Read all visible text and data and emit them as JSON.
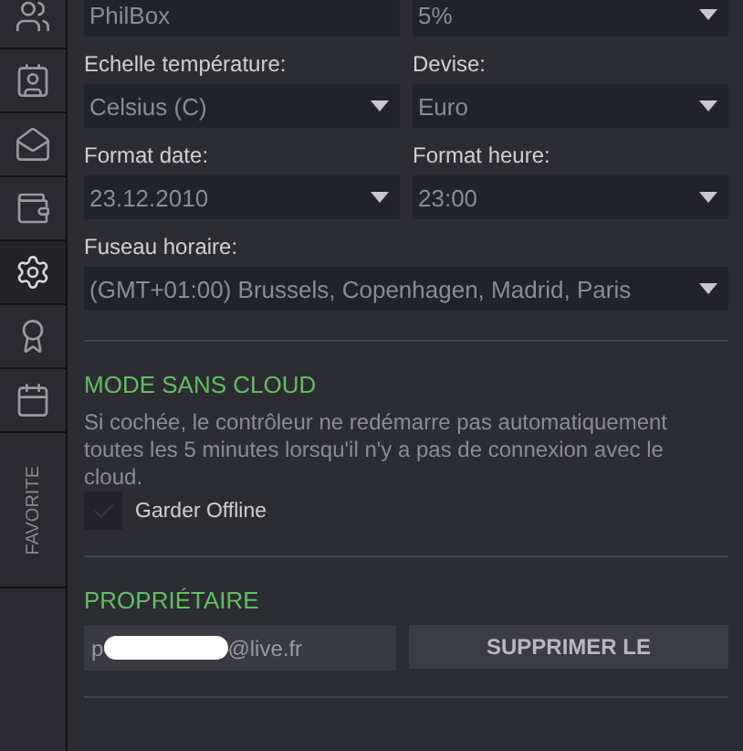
{
  "sidebar": {
    "items": [
      {
        "kind": "users",
        "selected": false
      },
      {
        "kind": "contacts",
        "selected": false
      },
      {
        "kind": "mail",
        "selected": false
      },
      {
        "kind": "wallet",
        "selected": false
      },
      {
        "kind": "settings",
        "selected": true
      },
      {
        "kind": "award",
        "selected": false
      },
      {
        "kind": "calendar",
        "selected": false
      }
    ],
    "favorite_label": "FAVORITE"
  },
  "settings": {
    "rows": [
      [
        {
          "value": "PhilBox",
          "kind": "text"
        },
        {
          "value": "5%",
          "kind": "select"
        }
      ],
      [
        {
          "label": "Echelle température:",
          "value": "Celsius (C)",
          "kind": "select"
        },
        {
          "label": "Devise:",
          "value": "Euro",
          "kind": "select"
        }
      ],
      [
        {
          "label": "Format date:",
          "value": "23.12.2010",
          "kind": "select"
        },
        {
          "label": "Format heure:",
          "value": "23:00",
          "kind": "select"
        }
      ],
      [
        {
          "label": "Fuseau horaire:",
          "value": "(GMT+01:00) Brussels, Copenhagen, Madrid, Paris",
          "kind": "select"
        }
      ]
    ]
  },
  "cloud": {
    "title": "MODE SANS CLOUD",
    "description": "Si cochée, le contrôleur ne redémarre pas automatiquement toutes les 5 minutes lorsqu'il n'y a pas de connexion avec le cloud.",
    "checkbox": {
      "label": "Garder Offline",
      "checked": false
    }
  },
  "owner": {
    "title": "PROPRIÉTAIRE",
    "email_start": "p",
    "email_end": "@live.fr",
    "button": "SUPPRIMER LE"
  }
}
